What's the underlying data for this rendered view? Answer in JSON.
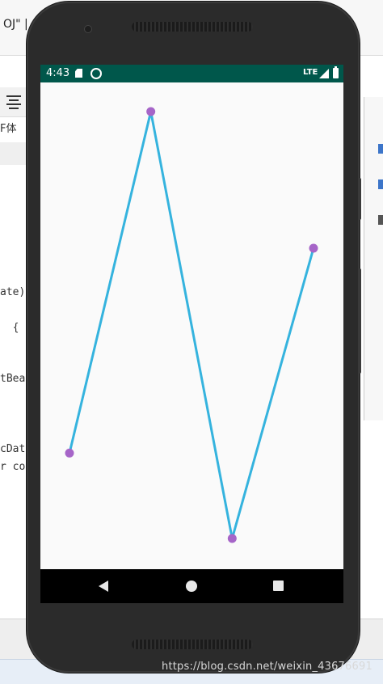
{
  "background": {
    "window_title": "OJ\" |",
    "font_name": "F体",
    "code_lines": [
      "ate)",
      "  {",
      "tBea",
      "cDate",
      "r co"
    ],
    "watermark": "https://blog.csdn.net/weixin_43676691"
  },
  "status_bar": {
    "time": "4:43",
    "network": "LTE",
    "color": "#00574b"
  },
  "chart_data": {
    "type": "line",
    "x": [
      0,
      1,
      2,
      3
    ],
    "values": [
      20,
      100,
      0,
      68
    ],
    "line_color": "#35b3de",
    "point_color": "#a665c8",
    "ylim": [
      0,
      100
    ],
    "grid": false,
    "title": "",
    "xlabel": "",
    "ylabel": ""
  },
  "nav_bar": {
    "back": "back-icon",
    "home": "home-icon",
    "recents": "recents-icon"
  }
}
